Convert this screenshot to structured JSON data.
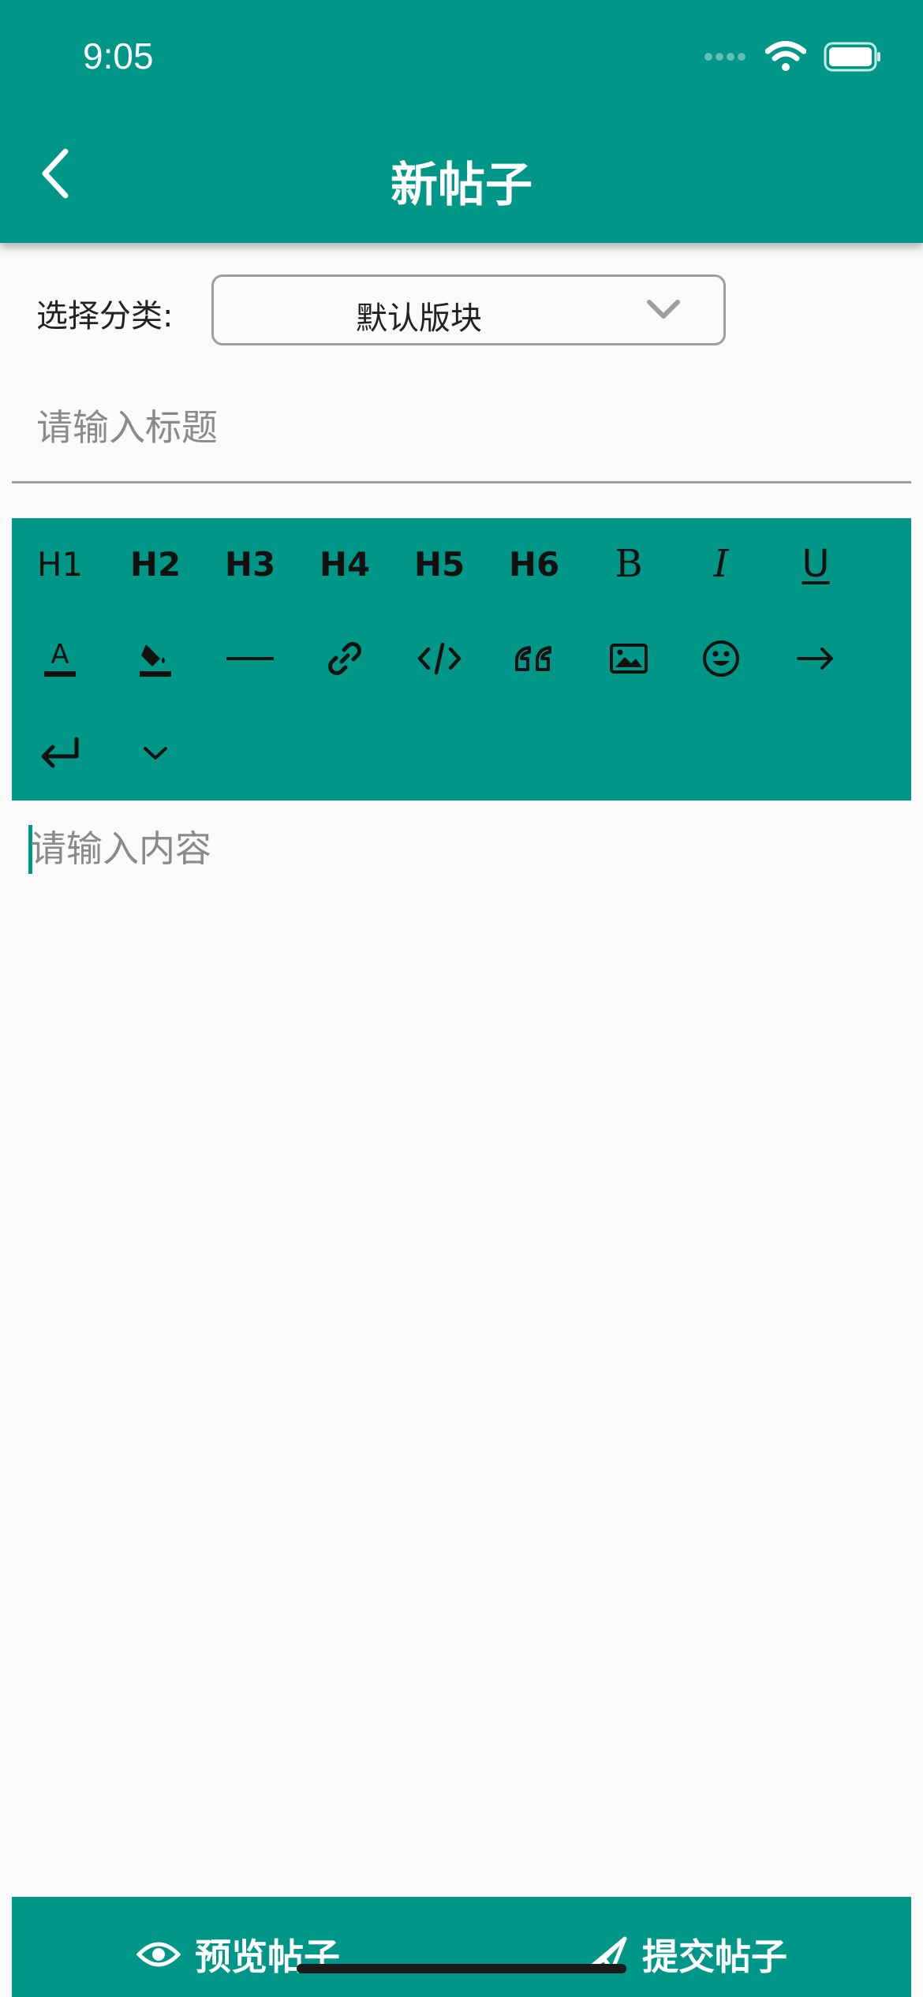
{
  "status": {
    "time": "9:05"
  },
  "header": {
    "title": "新帖子"
  },
  "category": {
    "label": "选择分类:",
    "value": "默认版块"
  },
  "title_input": {
    "placeholder": "请输入标题"
  },
  "toolbar": {
    "headings": [
      "H1",
      "H2",
      "H3",
      "H4",
      "H5",
      "H6"
    ],
    "bold": "B",
    "italic": "I",
    "underline": "U",
    "font_color_letter": "A",
    "icons": [
      "font-color-icon",
      "fill-color-icon",
      "horizontal-rule-icon",
      "link-icon",
      "code-icon",
      "quote-icon",
      "image-icon",
      "emoji-icon",
      "arrow-right-icon",
      "return-icon",
      "chevron-down-icon"
    ]
  },
  "content_input": {
    "placeholder": "请输入内容"
  },
  "bottom": {
    "preview_label": "预览帖子",
    "submit_label": "提交帖子"
  },
  "colors": {
    "accent": "#009688",
    "background": "#fafafa"
  }
}
